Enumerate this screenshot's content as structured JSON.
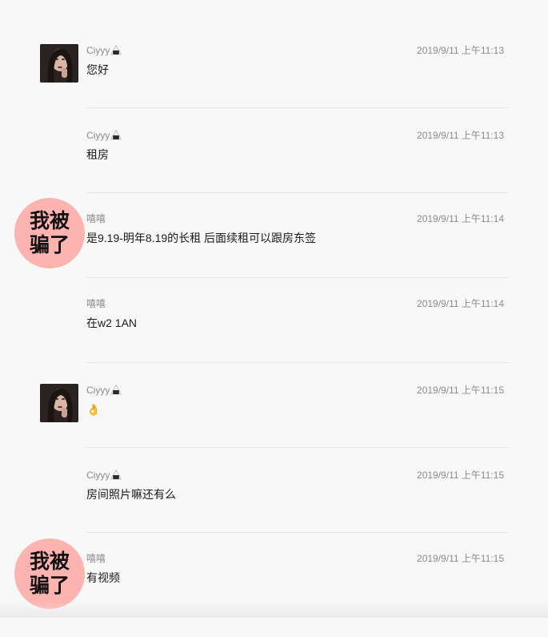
{
  "messages": [
    {
      "sender": "Ciyyy",
      "sender_icon": "rice-ball-icon",
      "show_avatar": true,
      "timestamp": "2019/9/11 上午11:13",
      "text": "您好"
    },
    {
      "sender": "Ciyyy",
      "sender_icon": "rice-ball-icon",
      "show_avatar": false,
      "timestamp": "2019/9/11 上午11:13",
      "text": "租房"
    },
    {
      "sender": "嘻嘻",
      "sender_icon": "",
      "show_avatar": false,
      "timestamp": "2019/9/11 上午11:14",
      "text": "是9.19-明年8.19的长租 后面续租可以跟房东签"
    },
    {
      "sender": "嘻嘻",
      "sender_icon": "",
      "show_avatar": false,
      "timestamp": "2019/9/11 上午11:14",
      "text": "在w2 1AN"
    },
    {
      "sender": "Ciyyy",
      "sender_icon": "rice-ball-icon",
      "show_avatar": true,
      "timestamp": "2019/9/11 上午11:15",
      "text": "👌"
    },
    {
      "sender": "Ciyyy",
      "sender_icon": "rice-ball-icon",
      "show_avatar": false,
      "timestamp": "2019/9/11 上午11:15",
      "text": "房间照片嘛还有么"
    },
    {
      "sender": "嘻嘻",
      "sender_icon": "",
      "show_avatar": false,
      "timestamp": "2019/9/11 上午11:15",
      "text": "有视频"
    }
  ],
  "stamps": [
    {
      "text": "我被骗了",
      "color": "#fdb4b0"
    },
    {
      "text": "我被骗了",
      "color": "#fdb4b0"
    }
  ]
}
